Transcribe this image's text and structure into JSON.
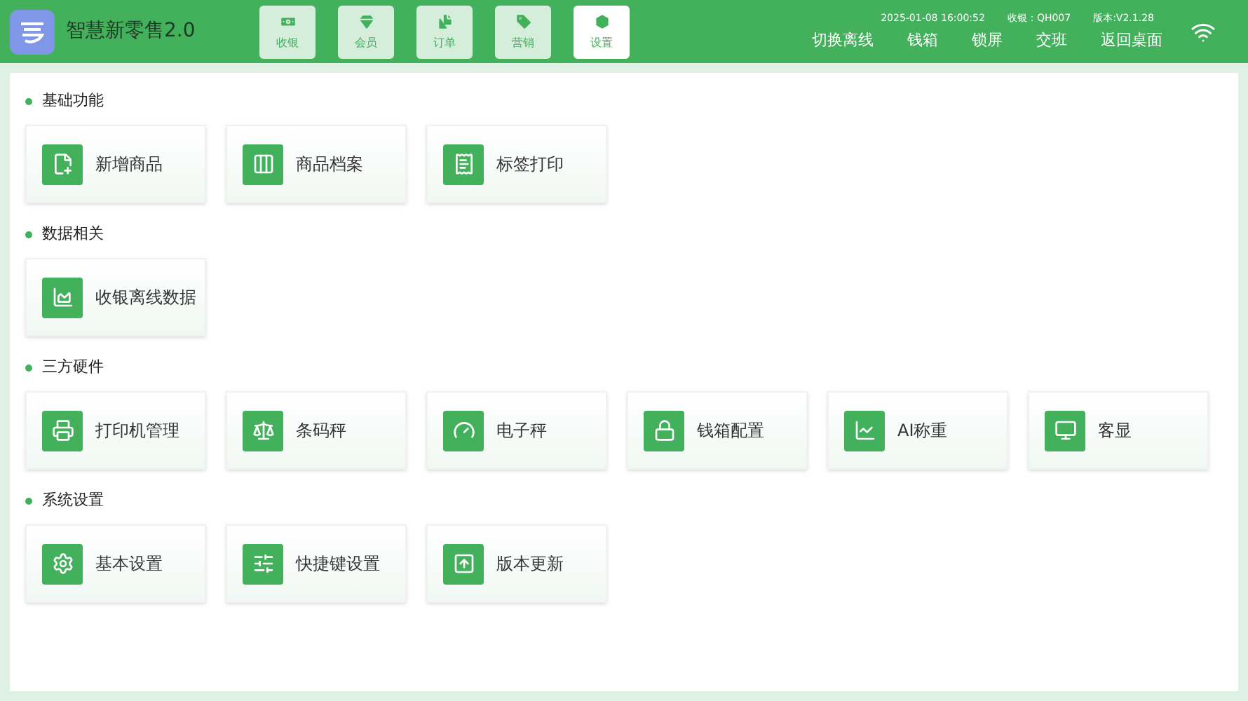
{
  "app": {
    "title": "智慧新零售2.0"
  },
  "nav_tabs": [
    {
      "label": "收银",
      "selected": false
    },
    {
      "label": "会员",
      "selected": false
    },
    {
      "label": "订单",
      "selected": false
    },
    {
      "label": "营销",
      "selected": false
    },
    {
      "label": "设置",
      "selected": true
    }
  ],
  "status": {
    "datetime": "2025-01-08 16:00:52",
    "cashier": "收银：QH007",
    "version": "版本:V2.1.28"
  },
  "actions": [
    "切换离线",
    "钱箱",
    "锁屏",
    "交班",
    "返回桌面"
  ],
  "sections": [
    {
      "title": "基础功能",
      "items": [
        "新增商品",
        "商品档案",
        "标签打印"
      ]
    },
    {
      "title": "数据相关",
      "items": [
        "收银离线数据"
      ]
    },
    {
      "title": "三方硬件",
      "items": [
        "打印机管理",
        "条码秤",
        "电子秤",
        "钱箱配置",
        "AI称重",
        "客显"
      ]
    },
    {
      "title": "系统设置",
      "items": [
        "基本设置",
        "快捷键设置",
        "版本更新"
      ]
    }
  ]
}
